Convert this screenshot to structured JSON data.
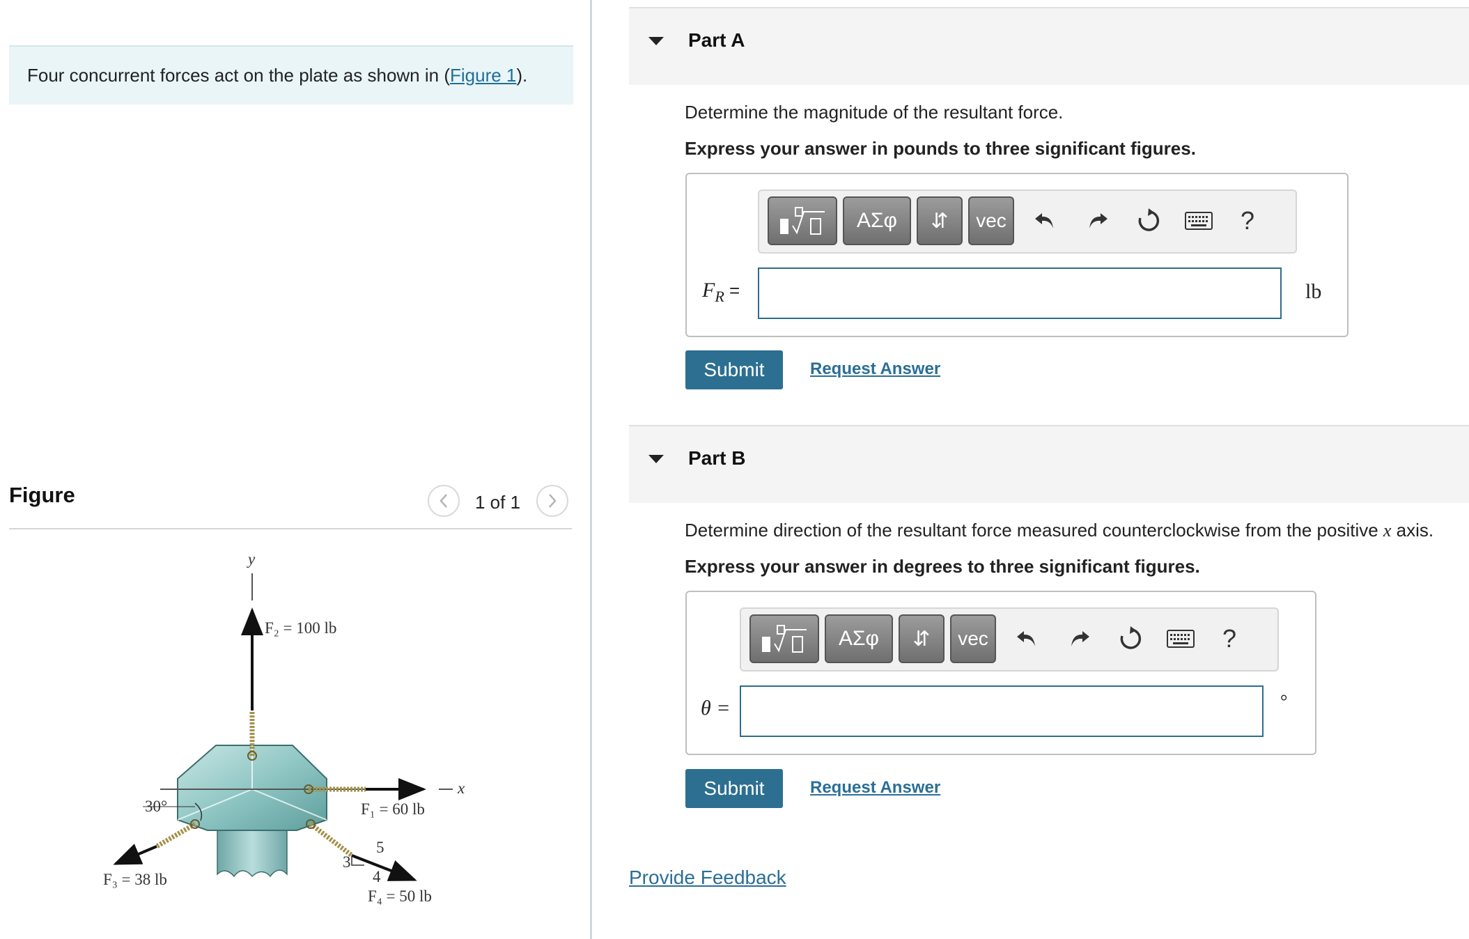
{
  "problem": {
    "intro_prefix": "Four concurrent forces act on the plate as shown in (",
    "figure_link": "Figure 1",
    "intro_suffix": ")."
  },
  "figure_panel": {
    "title": "Figure",
    "pager": "1 of 1",
    "prev_icon": "chevron-left-icon",
    "next_icon": "chevron-right-icon",
    "diagram": {
      "y_axis_label": "y",
      "x_axis_label": "x",
      "angle_label": "30°",
      "f2_label": "F₂ = 100 lb",
      "f1_label": "F₁ = 60 lb",
      "f3_label": "F₃ = 38 lb",
      "f4_label": "F₄ = 50 lb",
      "slope_run": "4",
      "slope_rise": "3",
      "slope_hyp": "5"
    }
  },
  "toolbar": {
    "template_icon": "fraction-sqrt-template-icon",
    "greek_label": "ΑΣφ",
    "arrows_label": "⇵",
    "vec_label": "vec",
    "undo_icon": "undo-icon",
    "redo_icon": "redo-icon",
    "reset_icon": "reset-icon",
    "keyboard_icon": "keyboard-icon",
    "help_label": "?"
  },
  "part_a": {
    "title": "Part A",
    "question": "Determine the magnitude of the resultant force.",
    "instruction": "Express your answer in pounds to three significant figures.",
    "field_label_main": "F",
    "field_label_sub": "R",
    "field_label_eq": " =",
    "input_value": "",
    "unit": "lb",
    "submit": "Submit",
    "request_answer": "Request Answer"
  },
  "part_b": {
    "title": "Part B",
    "question_prefix": "Determine direction of the resultant force measured counterclockwise from the positive ",
    "question_var": "x",
    "question_suffix": " axis.",
    "instruction": "Express your answer in degrees to three significant figures.",
    "field_label": "θ =",
    "input_value": "",
    "unit": "°",
    "submit": "Submit",
    "request_answer": "Request Answer"
  },
  "footer": {
    "feedback": "Provide Feedback"
  },
  "colors": {
    "accent": "#2c6f91",
    "link": "#2a6e97",
    "intro_bg": "#e9f5f7",
    "plate": "#9fd0cf"
  }
}
